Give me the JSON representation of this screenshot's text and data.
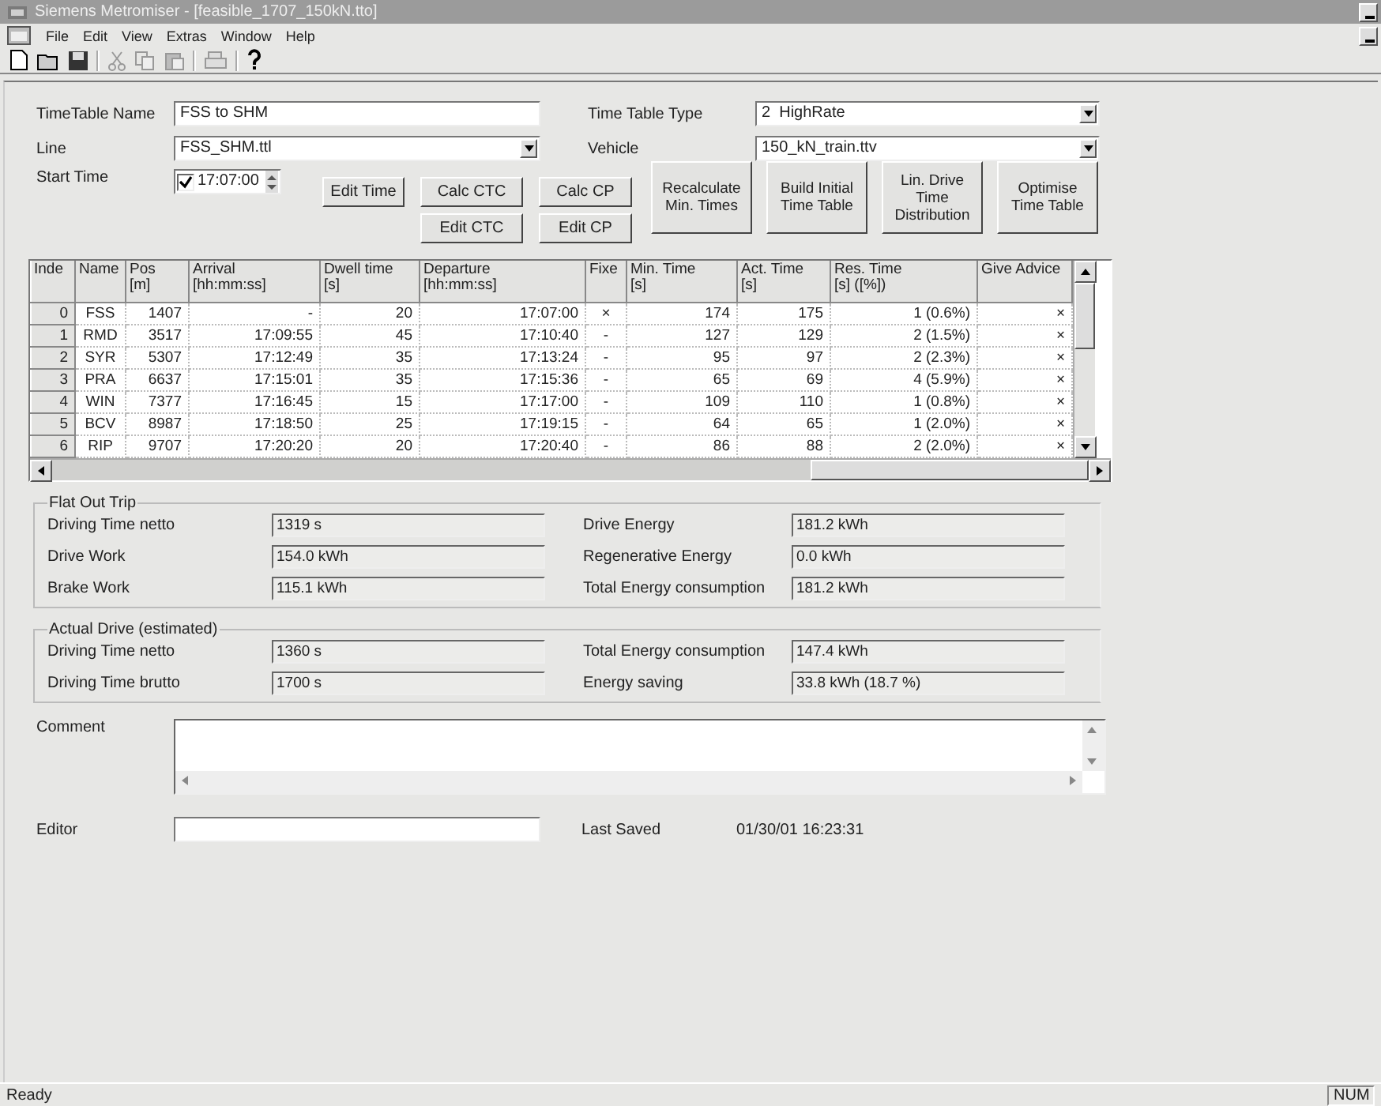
{
  "window": {
    "title": "Siemens Metromiser - [feasible_1707_150kN.tto]"
  },
  "menu": [
    "File",
    "Edit",
    "View",
    "Extras",
    "Window",
    "Help"
  ],
  "form": {
    "timetable_name": {
      "label": "TimeTable Name",
      "value": "FSS to SHM"
    },
    "line": {
      "label": "Line",
      "value": "FSS_SHM.ttl"
    },
    "start_time": {
      "label": "Start Time",
      "checked": true,
      "value": "17:07:00"
    },
    "time_table_type": {
      "label": "Time Table Type",
      "value": "2  HighRate"
    },
    "vehicle": {
      "label": "Vehicle",
      "value": "150_kN_train.ttv"
    }
  },
  "small_buttons": [
    "Edit Time",
    "Calc CTC",
    "Calc CP",
    "Edit CTC",
    "Edit CP"
  ],
  "big_buttons": [
    "Recalculate\nMin. Times",
    "Build Initial\nTime Table",
    "Lin. Drive\nTime\nDistribution",
    "Optimise\nTime Table"
  ],
  "table": {
    "columns": [
      "Inde",
      "Name",
      "Pos\n[m]",
      "Arrival\n[hh:mm:ss]",
      "Dwell time\n[s]",
      "Departure\n[hh:mm:ss]",
      "Fixe",
      "Min. Time\n[s]",
      "Act. Time\n[s]",
      "Res. Time\n[s] ([%])",
      "Give Advice"
    ],
    "rows": [
      [
        "0",
        "FSS",
        "1407",
        "-",
        "20",
        "17:07:00",
        "×",
        "174",
        "175",
        "1 (0.6%)",
        "×"
      ],
      [
        "1",
        "RMD",
        "3517",
        "17:09:55",
        "45",
        "17:10:40",
        "-",
        "127",
        "129",
        "2 (1.5%)",
        "×"
      ],
      [
        "2",
        "SYR",
        "5307",
        "17:12:49",
        "35",
        "17:13:24",
        "-",
        "95",
        "97",
        "2 (2.3%)",
        "×"
      ],
      [
        "3",
        "PRA",
        "6637",
        "17:15:01",
        "35",
        "17:15:36",
        "-",
        "65",
        "69",
        "4 (5.9%)",
        "×"
      ],
      [
        "4",
        "WIN",
        "7377",
        "17:16:45",
        "15",
        "17:17:00",
        "-",
        "109",
        "110",
        "1 (0.8%)",
        "×"
      ],
      [
        "5",
        "BCV",
        "8987",
        "17:18:50",
        "25",
        "17:19:15",
        "-",
        "64",
        "65",
        "1 (2.0%)",
        "×"
      ],
      [
        "6",
        "RIP",
        "9707",
        "17:20:20",
        "20",
        "17:20:40",
        "-",
        "86",
        "88",
        "2 (2.0%)",
        "×"
      ]
    ]
  },
  "groups": [
    {
      "title": "Flat Out Trip",
      "left": [
        {
          "label": "Driving Time netto",
          "value": "1319 s"
        },
        {
          "label": "Drive Work",
          "value": "154.0 kWh"
        },
        {
          "label": "Brake Work",
          "value": "115.1 kWh"
        }
      ],
      "right": [
        {
          "label": "Drive Energy",
          "value": "181.2 kWh"
        },
        {
          "label": "Regenerative Energy",
          "value": "0.0 kWh"
        },
        {
          "label": "Total Energy consumption",
          "value": "181.2 kWh"
        }
      ]
    },
    {
      "title": "Actual Drive (estimated)",
      "left": [
        {
          "label": "Driving Time netto",
          "value": "1360 s"
        },
        {
          "label": "Driving Time brutto",
          "value": "1700 s"
        }
      ],
      "right": [
        {
          "label": "Total Energy consumption",
          "value": "147.4 kWh"
        },
        {
          "label": "Energy saving",
          "value": "33.8 kWh (18.7 %)"
        }
      ]
    }
  ],
  "comment": {
    "label": "Comment"
  },
  "editor": {
    "label": "Editor"
  },
  "last_saved": {
    "label": "Last Saved",
    "value": "01/30/01 16:23:31"
  },
  "status_bar": {
    "text": "Ready",
    "indicator": "NUM"
  }
}
